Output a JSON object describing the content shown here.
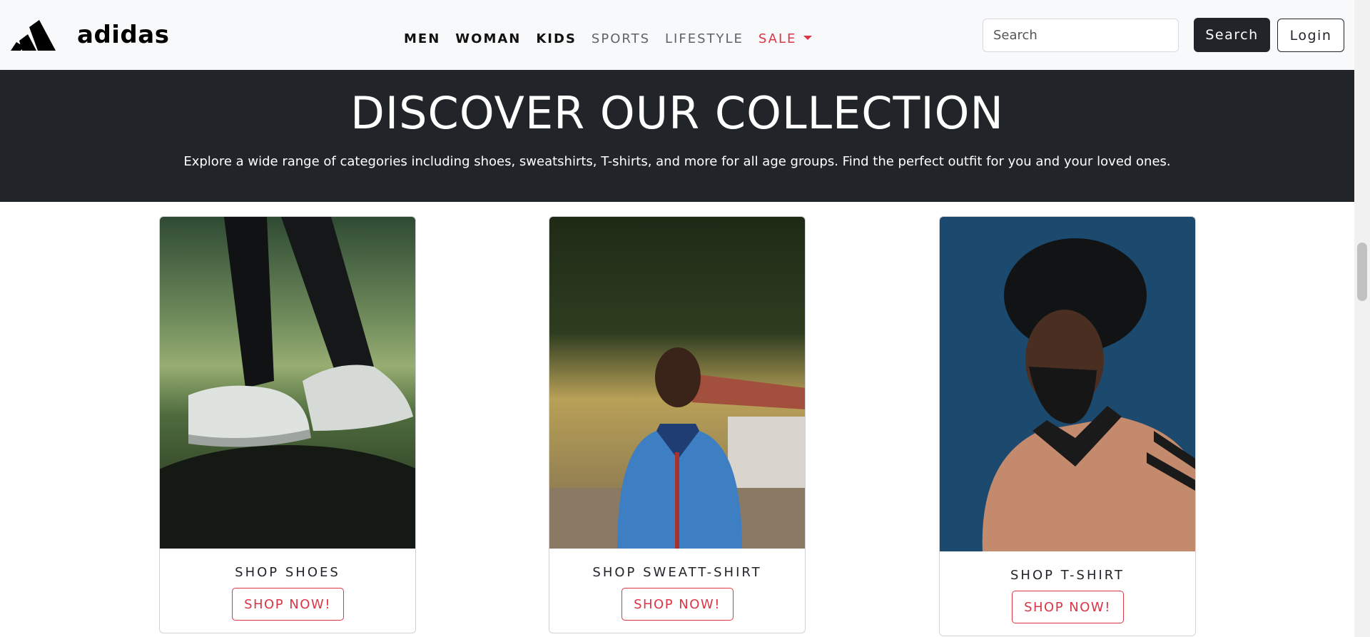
{
  "navbar": {
    "brand": "adidas",
    "links": [
      {
        "label": "MEN"
      },
      {
        "label": "WOMAN"
      },
      {
        "label": "KIDS"
      },
      {
        "label": "SPORTS"
      },
      {
        "label": "LIFESTYLE"
      },
      {
        "label": "SALE"
      }
    ],
    "search": {
      "placeholder": "Search",
      "button_label": "Search"
    },
    "login_label": "Login"
  },
  "hero": {
    "title": "DISCOVER OUR COLLECTION",
    "subtitle": "Explore a wide range of categories including shoes, sweatshirts, T-shirts, and more for all age groups. Find the perfect outfit for you and your loved ones."
  },
  "cards": [
    {
      "title": "SHOP SHOES",
      "button": "SHOP NOW!"
    },
    {
      "title": "SHOP SWEATT-SHIRT",
      "button": "SHOP NOW!"
    },
    {
      "title": "SHOP T-SHIRT",
      "button": "SHOP NOW!"
    }
  ],
  "colors": {
    "dark": "#212529",
    "accent_red": "#dc3545",
    "navbar_bg": "#f8f9fa"
  },
  "icons": [
    "adidas-logo-icon",
    "caret-down-icon"
  ]
}
